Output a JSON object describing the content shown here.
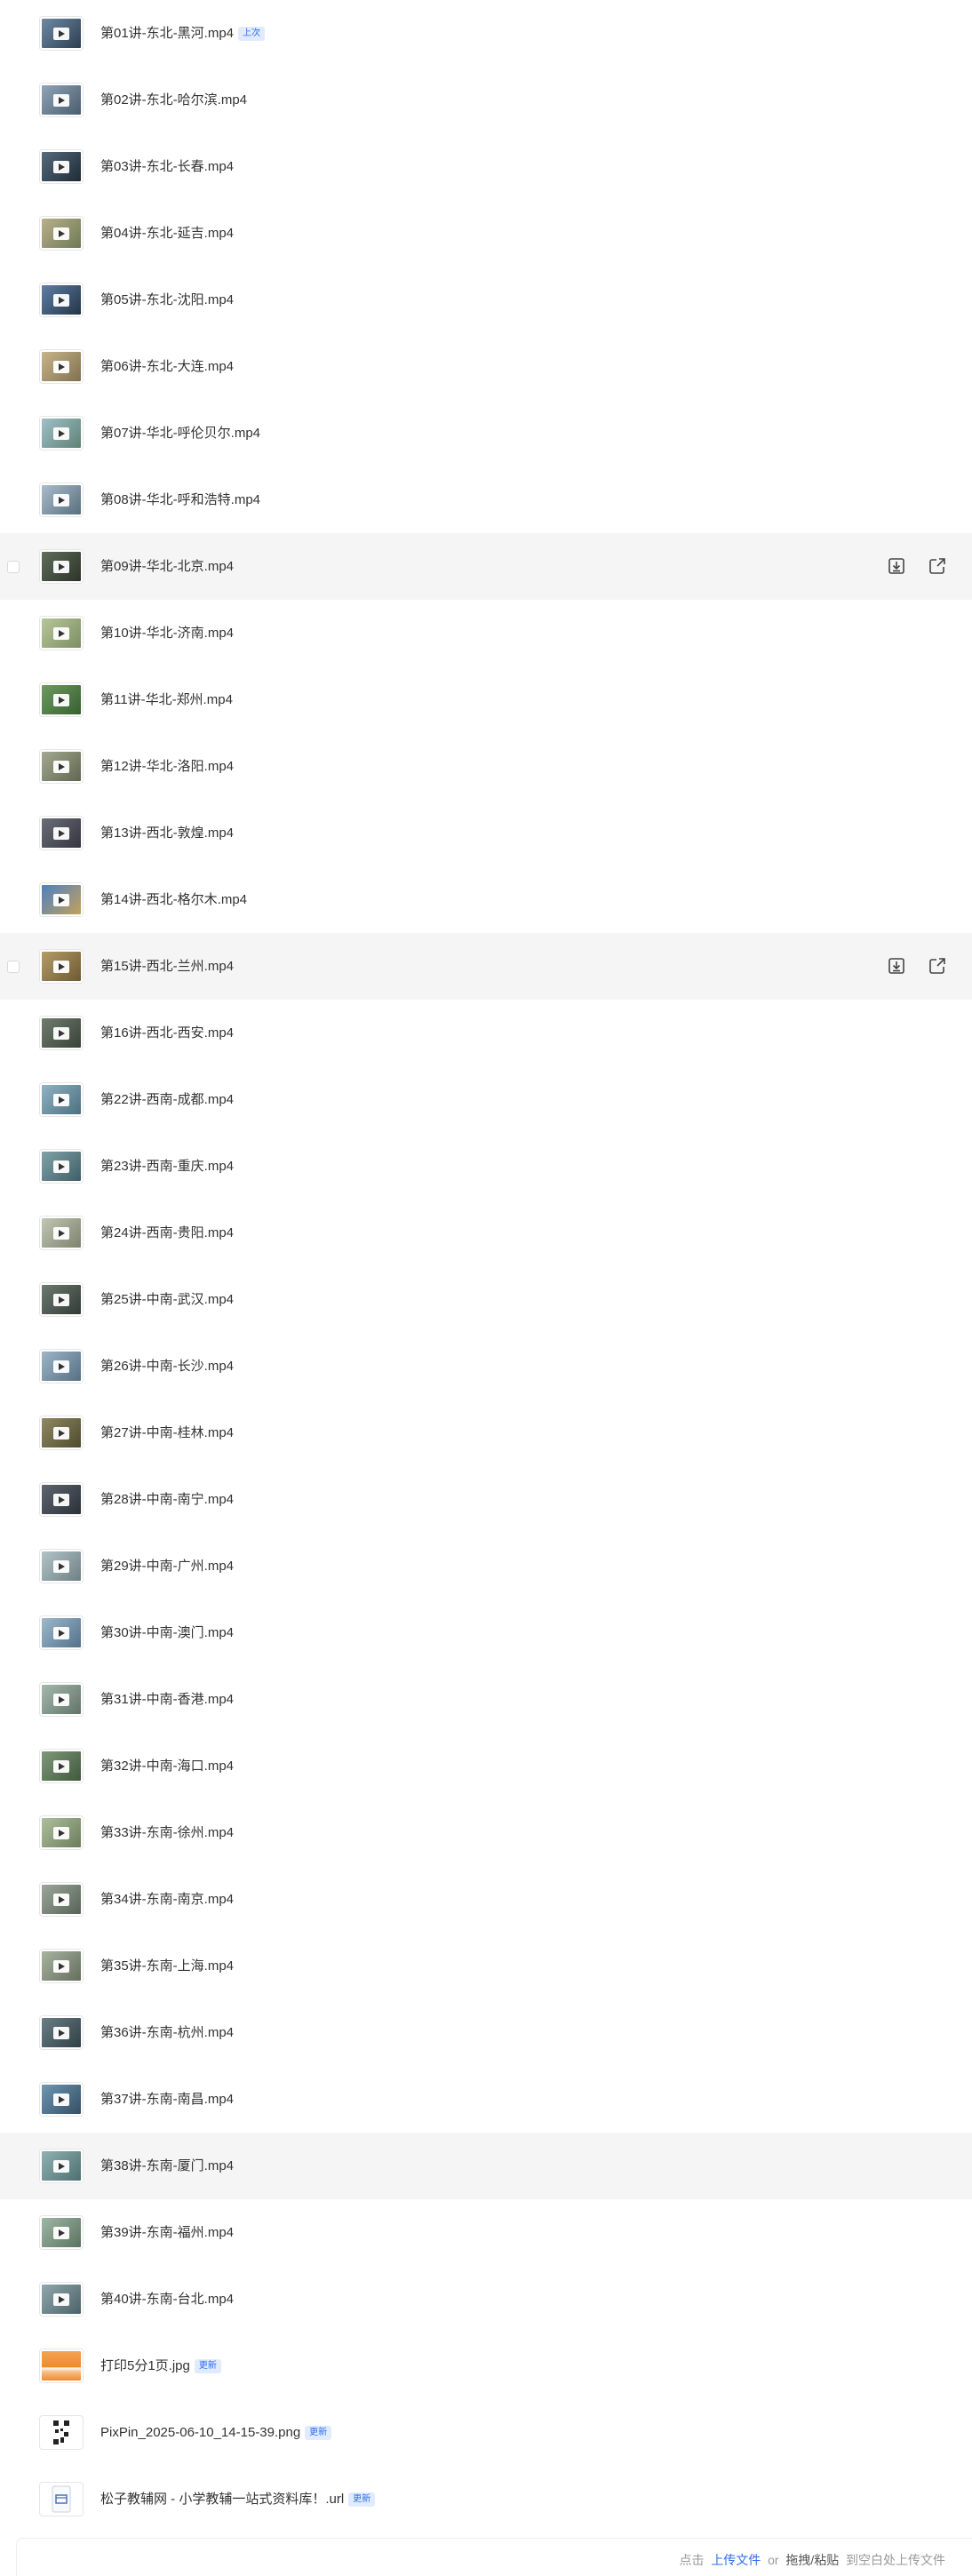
{
  "files": [
    {
      "name": "第01讲-东北-黑河.mp4",
      "type": "video",
      "tag": "上次",
      "thumb": [
        "#6f8aa6",
        "#2c3e50"
      ]
    },
    {
      "name": "第02讲-东北-哈尔滨.mp4",
      "type": "video",
      "thumb": [
        "#8fa4b8",
        "#4a5d6e"
      ]
    },
    {
      "name": "第03讲-东北-长春.mp4",
      "type": "video",
      "thumb": [
        "#556b7d",
        "#1f2b36"
      ]
    },
    {
      "name": "第04讲-东北-延吉.mp4",
      "type": "video",
      "thumb": [
        "#b9b08a",
        "#6d7a55"
      ]
    },
    {
      "name": "第05讲-东北-沈阳.mp4",
      "type": "video",
      "thumb": [
        "#5e7fa6",
        "#253447"
      ]
    },
    {
      "name": "第06讲-东北-大连.mp4",
      "type": "video",
      "thumb": [
        "#c8b489",
        "#7f7150"
      ]
    },
    {
      "name": "第07讲-华北-呼伦贝尔.mp4",
      "type": "video",
      "thumb": [
        "#9fc0c8",
        "#5e8276"
      ]
    },
    {
      "name": "第08讲-华北-呼和浩特.mp4",
      "type": "video",
      "thumb": [
        "#a8bccb",
        "#5a6f7d"
      ]
    },
    {
      "name": "第09讲-华北-北京.mp4",
      "type": "video",
      "thumb": [
        "#5f6e5a",
        "#2d3329"
      ],
      "highlight": true,
      "actions": true
    },
    {
      "name": "第10讲-华北-济南.mp4",
      "type": "video",
      "thumb": [
        "#b7c69a",
        "#7c8f62"
      ]
    },
    {
      "name": "第11讲-华北-郑州.mp4",
      "type": "video",
      "thumb": [
        "#6d9b62",
        "#37602f"
      ]
    },
    {
      "name": "第12讲-华北-洛阳.mp4",
      "type": "video",
      "thumb": [
        "#a4a890",
        "#60664f"
      ]
    },
    {
      "name": "第13讲-西北-敦煌.mp4",
      "type": "video",
      "thumb": [
        "#6b6e78",
        "#33363f"
      ]
    },
    {
      "name": "第14讲-西北-格尔木.mp4",
      "type": "video",
      "thumb": [
        "#4f7fc2",
        "#c2a25a"
      ]
    },
    {
      "name": "第15讲-西北-兰州.mp4",
      "type": "video",
      "thumb": [
        "#b59b66",
        "#6d5a35"
      ],
      "highlight": true,
      "actions": true
    },
    {
      "name": "第16讲-西北-西安.mp4",
      "type": "video",
      "thumb": [
        "#6f7d6e",
        "#3a4238"
      ]
    },
    {
      "name": "第22讲-西南-成都.mp4",
      "type": "video",
      "thumb": [
        "#8fb3c4",
        "#4d6f80"
      ]
    },
    {
      "name": "第23讲-西南-重庆.mp4",
      "type": "video",
      "thumb": [
        "#7fa2a8",
        "#3f5f66"
      ]
    },
    {
      "name": "第24讲-西南-贵阳.mp4",
      "type": "video",
      "thumb": [
        "#c2c7b5",
        "#7c826c"
      ]
    },
    {
      "name": "第25讲-中南-武汉.mp4",
      "type": "video",
      "thumb": [
        "#6c7a70",
        "#323b35"
      ]
    },
    {
      "name": "第26讲-中南-长沙.mp4",
      "type": "video",
      "thumb": [
        "#9cb5c8",
        "#566f82"
      ]
    },
    {
      "name": "第27讲-中南-桂林.mp4",
      "type": "video",
      "thumb": [
        "#8f8a60",
        "#4f4a2e"
      ]
    },
    {
      "name": "第28讲-中南-南宁.mp4",
      "type": "video",
      "thumb": [
        "#5d6570",
        "#2b3139"
      ]
    },
    {
      "name": "第29讲-中南-广州.mp4",
      "type": "video",
      "thumb": [
        "#b3c4c8",
        "#6f8084"
      ]
    },
    {
      "name": "第30讲-中南-澳门.mp4",
      "type": "video",
      "thumb": [
        "#9db9cc",
        "#55718a"
      ]
    },
    {
      "name": "第31讲-中南-香港.mp4",
      "type": "video",
      "thumb": [
        "#a5b8ad",
        "#627468"
      ]
    },
    {
      "name": "第32讲-中南-海口.mp4",
      "type": "video",
      "thumb": [
        "#7f9a7a",
        "#40573c"
      ]
    },
    {
      "name": "第33讲-东南-徐州.mp4",
      "type": "video",
      "thumb": [
        "#aebf9e",
        "#6b7d5b"
      ]
    },
    {
      "name": "第34讲-东南-南京.mp4",
      "type": "video",
      "thumb": [
        "#9aa79a",
        "#566356"
      ]
    },
    {
      "name": "第35讲-东南-上海.mp4",
      "type": "video",
      "thumb": [
        "#a8b3a0",
        "#636e5c"
      ]
    },
    {
      "name": "第36讲-东南-杭州.mp4",
      "type": "video",
      "thumb": [
        "#6a7f86",
        "#2f3f45"
      ]
    },
    {
      "name": "第37讲-东南-南昌.mp4",
      "type": "video",
      "thumb": [
        "#6f97b5",
        "#344f63"
      ]
    },
    {
      "name": "第38讲-东南-厦门.mp4",
      "type": "video",
      "thumb": [
        "#8fb2b3",
        "#4e6f70"
      ],
      "highlight": true
    },
    {
      "name": "第39讲-东南-福州.mp4",
      "type": "video",
      "thumb": [
        "#9fb7a4",
        "#5a7260"
      ]
    },
    {
      "name": "第40讲-东南-台北.mp4",
      "type": "video",
      "thumb": [
        "#8fa7ad",
        "#4c6268"
      ]
    },
    {
      "name": "打印5分1页.jpg",
      "type": "image-orange",
      "tag": "更新"
    },
    {
      "name": "PixPin_2025-06-10_14-15-39.png",
      "type": "qr",
      "tag": "更新"
    },
    {
      "name": "松子教辅网 - 小学教辅一站式资料库！.url",
      "type": "url",
      "tag": "更新"
    }
  ],
  "icons": {
    "download": "download-icon",
    "share": "share-icon",
    "play": "play-icon"
  },
  "upload": {
    "prefix": "点击",
    "link": "上传文件",
    "or": "or",
    "drag": "拖拽/粘贴",
    "suffix": "到空白处上传文件"
  },
  "colors": {
    "accent": "#2e6ee6",
    "tag_bg": "#e0ebff",
    "highlight_bg": "#f5f5f5"
  }
}
